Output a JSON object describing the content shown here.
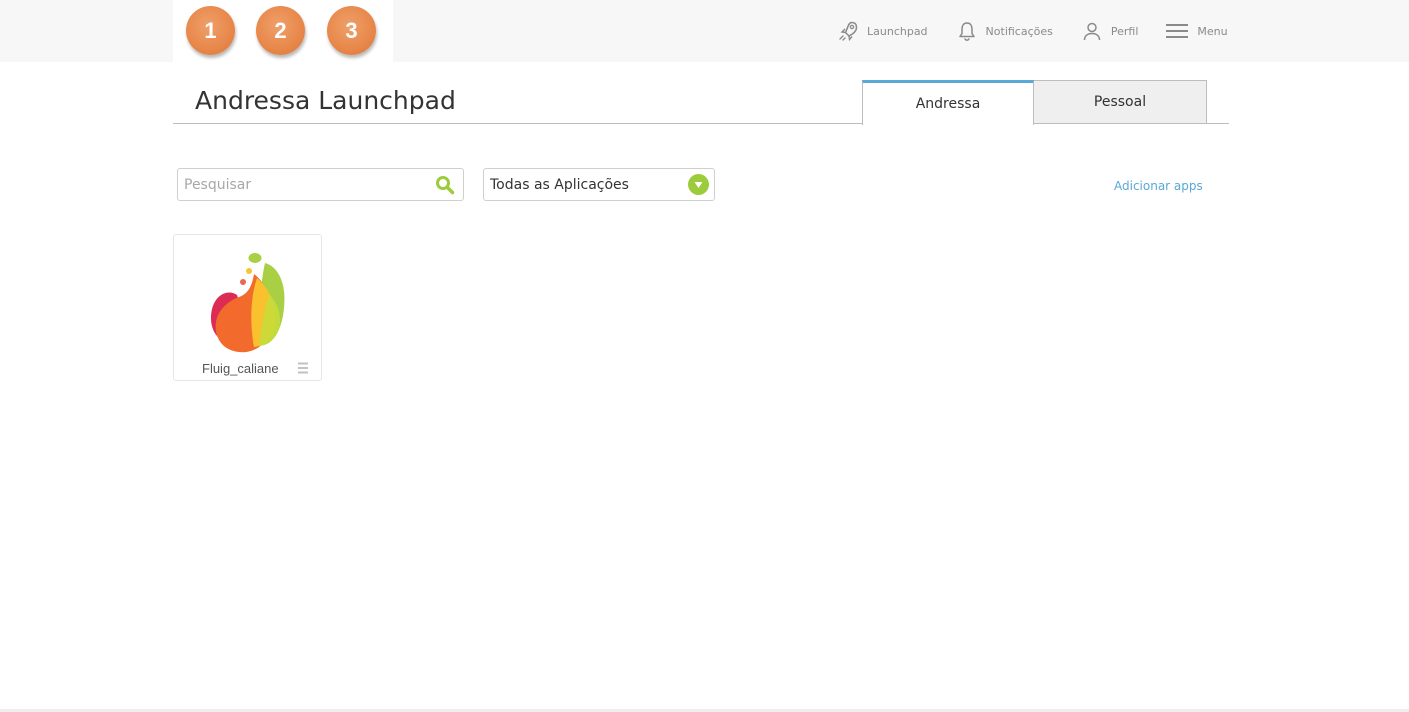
{
  "header": {
    "steps": [
      "1",
      "2",
      "3"
    ],
    "nav": {
      "launchpad": "Launchpad",
      "notifications": "Notificações",
      "profile": "Perfil",
      "menu": "Menu"
    }
  },
  "page": {
    "title": "Andressa Launchpad",
    "tabs": [
      {
        "label": "Andressa",
        "active": true
      },
      {
        "label": "Pessoal",
        "active": false
      }
    ]
  },
  "filters": {
    "search_placeholder": "Pesquisar",
    "search_value": "",
    "category_selected": "Todas as Aplicações",
    "add_apps_label": "Adicionar apps"
  },
  "apps": [
    {
      "name": "Fluig_caliane",
      "icon": "fluig-logo-icon"
    }
  ],
  "colors": {
    "step_orange": "#e8874a",
    "accent_blue": "#5aa8d6",
    "accent_green": "#9ccb3b",
    "topbar_bg": "#f7f7f7"
  }
}
